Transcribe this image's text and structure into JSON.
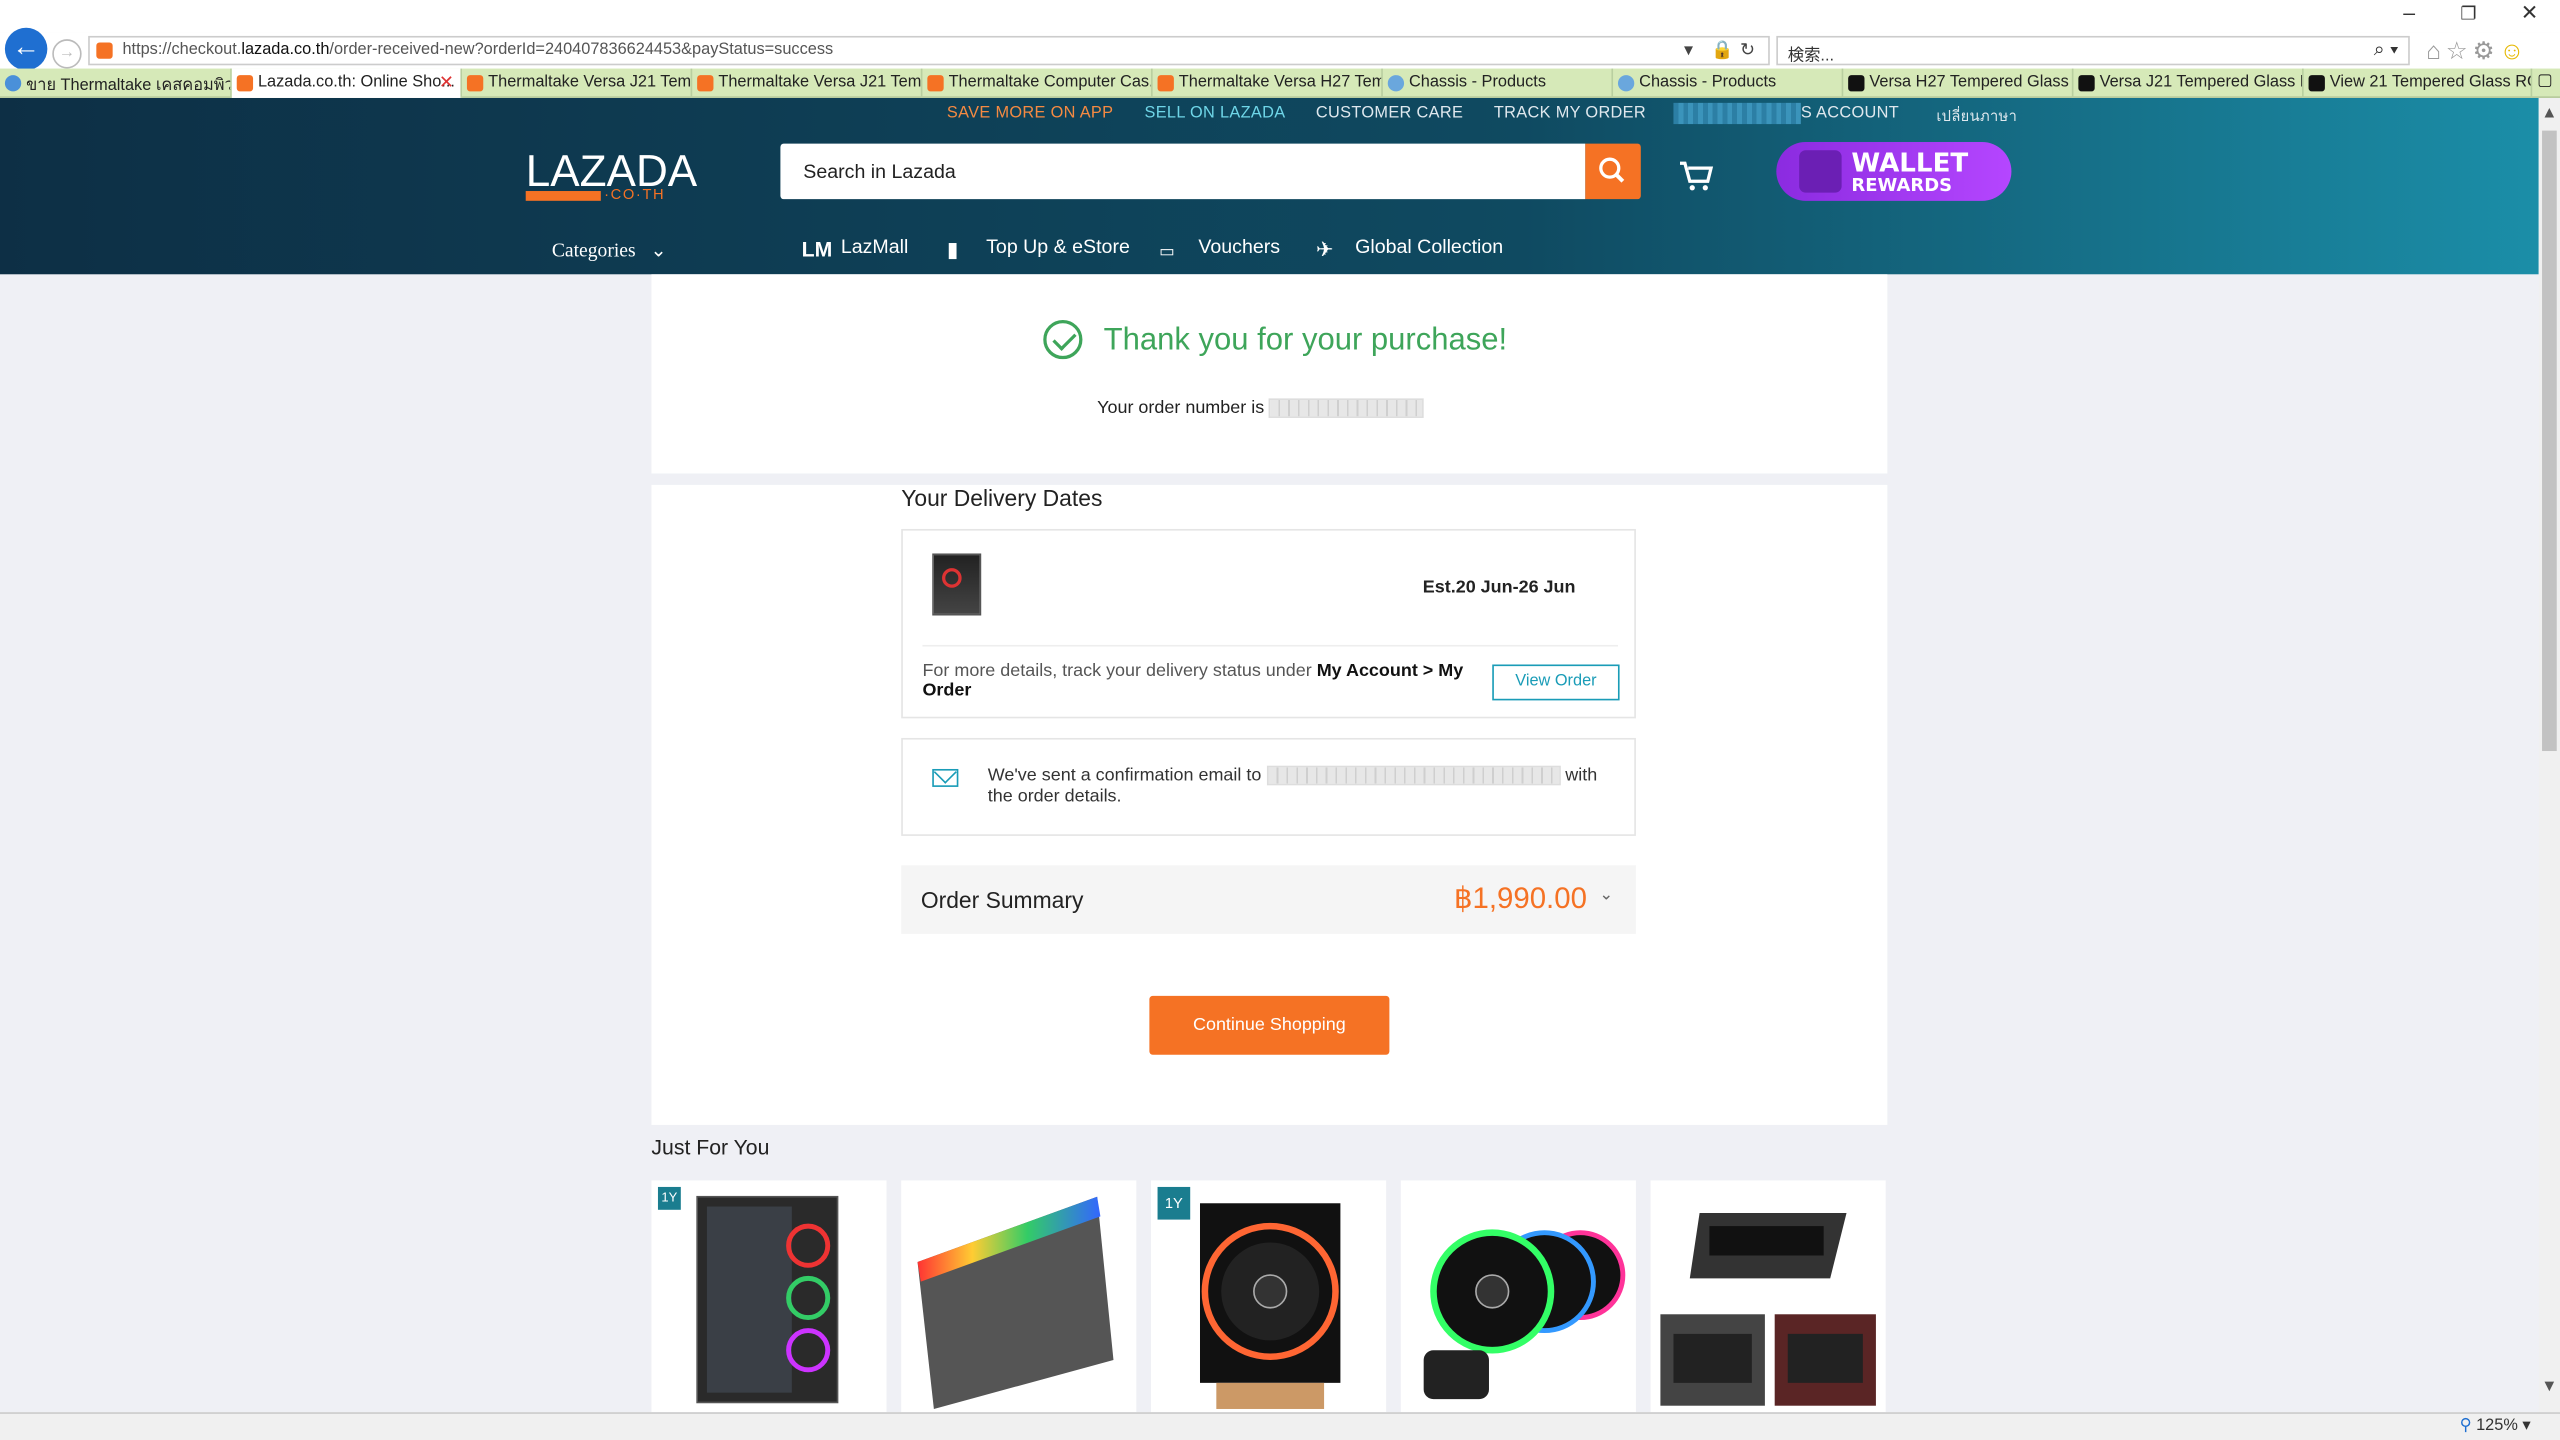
{
  "browser": {
    "url_host": "https://checkout.",
    "url_bold": "lazada.co.th",
    "url_rest": "/order-received-new?orderId=240407836624453&payStatus=success",
    "search_placeholder": "検索...",
    "zoom": "125%",
    "tabs": [
      {
        "label": "ขาย Thermaltake เคสคอมพิวเ..."
      },
      {
        "label": "Lazada.co.th: Online Sho..."
      },
      {
        "label": "Thermaltake Versa J21 Tem..."
      },
      {
        "label": "Thermaltake Versa J21 Tem..."
      },
      {
        "label": "Thermaltake Computer Cas..."
      },
      {
        "label": "Thermaltake Versa H27 Tem..."
      },
      {
        "label": "Chassis - Products"
      },
      {
        "label": "Chassis - Products"
      },
      {
        "label": "Versa H27 Tempered Glass ..."
      },
      {
        "label": "Versa J21 Tempered Glass E..."
      },
      {
        "label": "View 21 Tempered Glass RG..."
      }
    ]
  },
  "header": {
    "top_links": [
      "SAVE MORE ON APP",
      "SELL ON LAZADA",
      "CUSTOMER CARE",
      "TRACK MY ORDER",
      "S ACCOUNT",
      "เปลี่ยนภาษา"
    ],
    "logo": "LAZADA",
    "logo_sub": "·CO·TH",
    "search_placeholder": "Search in Lazada",
    "wallet_line1": "WALLET",
    "wallet_line2": "REWARDS",
    "categories": "Categories",
    "nav": [
      "LazMall",
      "Top Up & eStore",
      "Vouchers",
      "Global Collection"
    ]
  },
  "confirmation": {
    "thanks": "Thank you for your purchase!",
    "order_number_label": "Your order number is"
  },
  "delivery": {
    "title": "Your Delivery Dates",
    "estimate": "Est.20 Jun-26 Jun",
    "details_prefix": "For more details, track your delivery status under ",
    "details_bold": "My Account > My Order",
    "view_order": "View Order",
    "email_prefix": "We've sent a confirmation email to",
    "email_suffix": "with the order details."
  },
  "summary": {
    "label": "Order Summary",
    "amount": "฿1,990.00"
  },
  "continue_label": "Continue Shopping",
  "just_for_you": "Just For You",
  "products": [
    {
      "name": "PC case",
      "badge": "1Y"
    },
    {
      "name": "RGB RAM",
      "badge": ""
    },
    {
      "name": "CPU cooler",
      "badge": "1Y"
    },
    {
      "name": "RGB fans",
      "badge": ""
    },
    {
      "name": "Fan controller",
      "badge": ""
    }
  ],
  "colors": {
    "accent": "#f57224",
    "success": "#3ea55a",
    "link": "#1a9cb7",
    "header_dark": "#0d2f45"
  }
}
